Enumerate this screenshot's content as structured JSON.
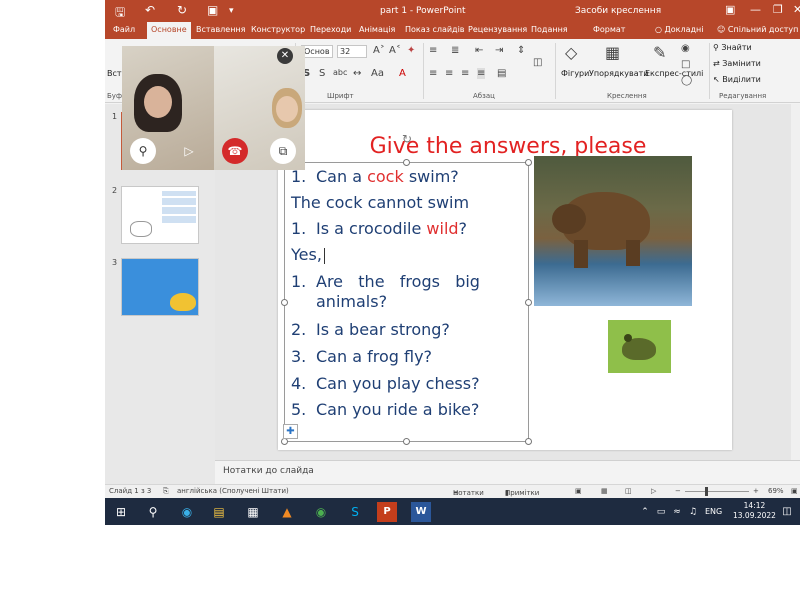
{
  "titlebar": {
    "doc_title": "part 1 - PowerPoint",
    "tools_title": "Засоби креслення",
    "save_icon": "save-icon",
    "undo_icon": "undo-icon",
    "redo_icon": "redo-icon",
    "present_icon": "present-icon"
  },
  "tabs": {
    "file": "Файл",
    "home": "Основне",
    "insert": "Вставлення",
    "design": "Конструктор",
    "transitions": "Переходи",
    "animations": "Анімація",
    "slideshow": "Показ слайдів",
    "review": "Рецензування",
    "view": "Подання",
    "format": "Формат",
    "tell_me": "Докладні",
    "share": "Спільний доступ"
  },
  "ribbon": {
    "paste": "Вста",
    "clipboard_label": "Буфе",
    "font_name": "Основ",
    "font_size": "32",
    "font_label": "Шрифт",
    "paragraph_label": "Абзац",
    "shapes": "Фігури",
    "arrange": "Упорядкувати",
    "quick_styles": "Експрес-стилі",
    "drawing_label": "Креслення",
    "find": "Знайти",
    "replace": "Замінити",
    "select": "Виділити",
    "editing_label": "Редагування"
  },
  "thumbnails": [
    {
      "num": "1"
    },
    {
      "num": "2"
    },
    {
      "num": "3"
    }
  ],
  "slide": {
    "title": "Give the answers, please",
    "lines": [
      {
        "num": "1.",
        "pre": "Can a ",
        "hl": "cock",
        "post": " swim?"
      },
      {
        "num": "",
        "pre": "The cock cannot swim",
        "hl": "",
        "post": ""
      },
      {
        "num": "1.",
        "pre": "Is a crocodile ",
        "hl": "wild",
        "post": "?"
      },
      {
        "num": "",
        "pre": "Yes,",
        "hl": "",
        "post": ""
      },
      {
        "num": "1.",
        "pre": "Are   the   frogs   big",
        "hl": "",
        "post": ""
      },
      {
        "num": "",
        "pre": "animals?",
        "hl": "",
        "post": ""
      },
      {
        "num": "2.",
        "pre": "Is a bear strong?",
        "hl": "",
        "post": ""
      },
      {
        "num": "3.",
        "pre": "Can a frog fly?",
        "hl": "",
        "post": ""
      },
      {
        "num": "4.",
        "pre": "Can you play chess?",
        "hl": "",
        "post": ""
      },
      {
        "num": "5.",
        "pre": "Can you ride a bike?",
        "hl": "",
        "post": ""
      }
    ]
  },
  "notes": {
    "placeholder": "Нотатки до слайда"
  },
  "status": {
    "slide_of": "Слайд 1 з 3",
    "language": "англійська (Сполучені Штати)",
    "notes": "Нотатки",
    "comments": "Примітки",
    "zoom": "69%"
  },
  "taskbar": {
    "lang": "ENG",
    "time": "14:12",
    "date": "13.09.2022"
  },
  "colors": {
    "accent": "#b7472a",
    "title_red": "#e22222",
    "body_blue": "#1f3f74",
    "taskbar": "#1e2b40"
  }
}
